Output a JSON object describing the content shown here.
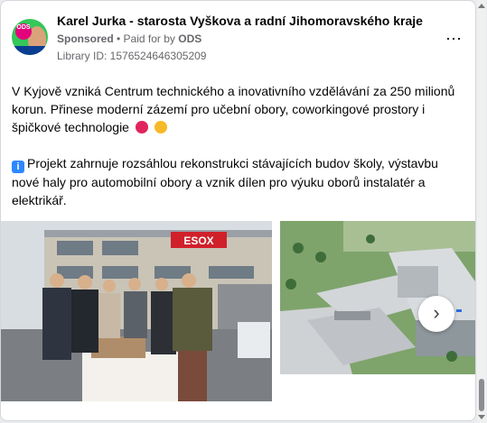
{
  "post": {
    "author": "Karel Jurka - starosta Vyškova a radní Jihomoravského kraje",
    "sponsored": "Sponsored",
    "paid_prefix": "• Paid for by",
    "paid_by": "ODS",
    "library_id": "Library ID: 1576524646305209",
    "more_icon": "⋯",
    "avatar_badge": "ODS"
  },
  "body": {
    "para1": "V Kyjově vzniká Centrum technického a inovativního vzdělávání za 250 milionů korun. Přinese moderní zázemí pro učební obory, coworkingové prostory i špičkové technologie",
    "para2": "Projekt zahrnuje rozsáhlou rekonstrukci stávajících budov školy, výstavbu nové haly pro automobilní obory a vznik dílen pro výuku oborů instalatér a elektrikář.",
    "ellipsis": "...",
    "info_glyph": "i"
  },
  "carousel": {
    "sign_text": "ESOX",
    "next_glyph": "›"
  }
}
